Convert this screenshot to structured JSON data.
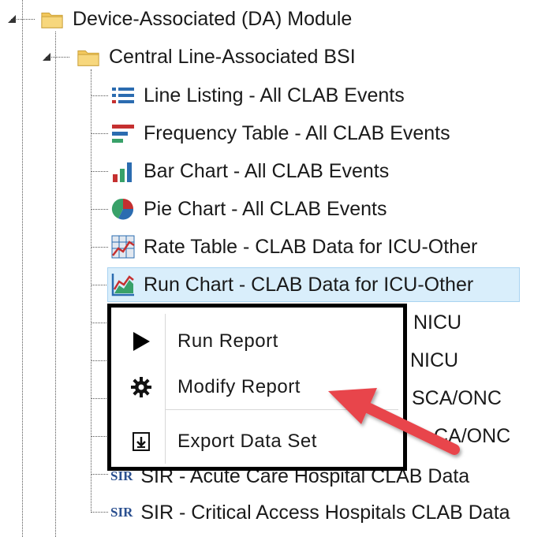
{
  "tree": {
    "module": {
      "label": "Device-Associated (DA) Module"
    },
    "folder": {
      "label": "Central Line-Associated BSI"
    },
    "items": [
      {
        "label": "Line Listing - All CLAB Events",
        "icon": "line-listing-icon"
      },
      {
        "label": "Frequency Table - All CLAB Events",
        "icon": "frequency-table-icon"
      },
      {
        "label": "Bar Chart - All CLAB Events",
        "icon": "bar-chart-icon"
      },
      {
        "label": "Pie Chart - All CLAB Events",
        "icon": "pie-chart-icon"
      },
      {
        "label": "Rate Table - CLAB Data for ICU-Other",
        "icon": "rate-table-icon"
      },
      {
        "label": "Run Chart - CLAB Data for ICU-Other",
        "icon": "run-chart-icon"
      }
    ],
    "obscured_tails": [
      "NICU",
      "NICU",
      "SCA/ONC",
      "CA/ONC"
    ],
    "sir_items": [
      {
        "badge": "SIR",
        "label": "SIR - Acute Care Hospital CLAB Data"
      },
      {
        "badge": "SIR",
        "label": "SIR - Critical Access Hospitals CLAB Data"
      }
    ]
  },
  "context_menu": {
    "items": [
      {
        "label": "Run Report",
        "icon": "play-icon"
      },
      {
        "label": "Modify Report",
        "icon": "gear-icon"
      },
      {
        "label": "Export Data Set",
        "icon": "export-icon"
      }
    ]
  },
  "colors": {
    "selection": "#d9eefb",
    "arrow": "#e8454c"
  }
}
